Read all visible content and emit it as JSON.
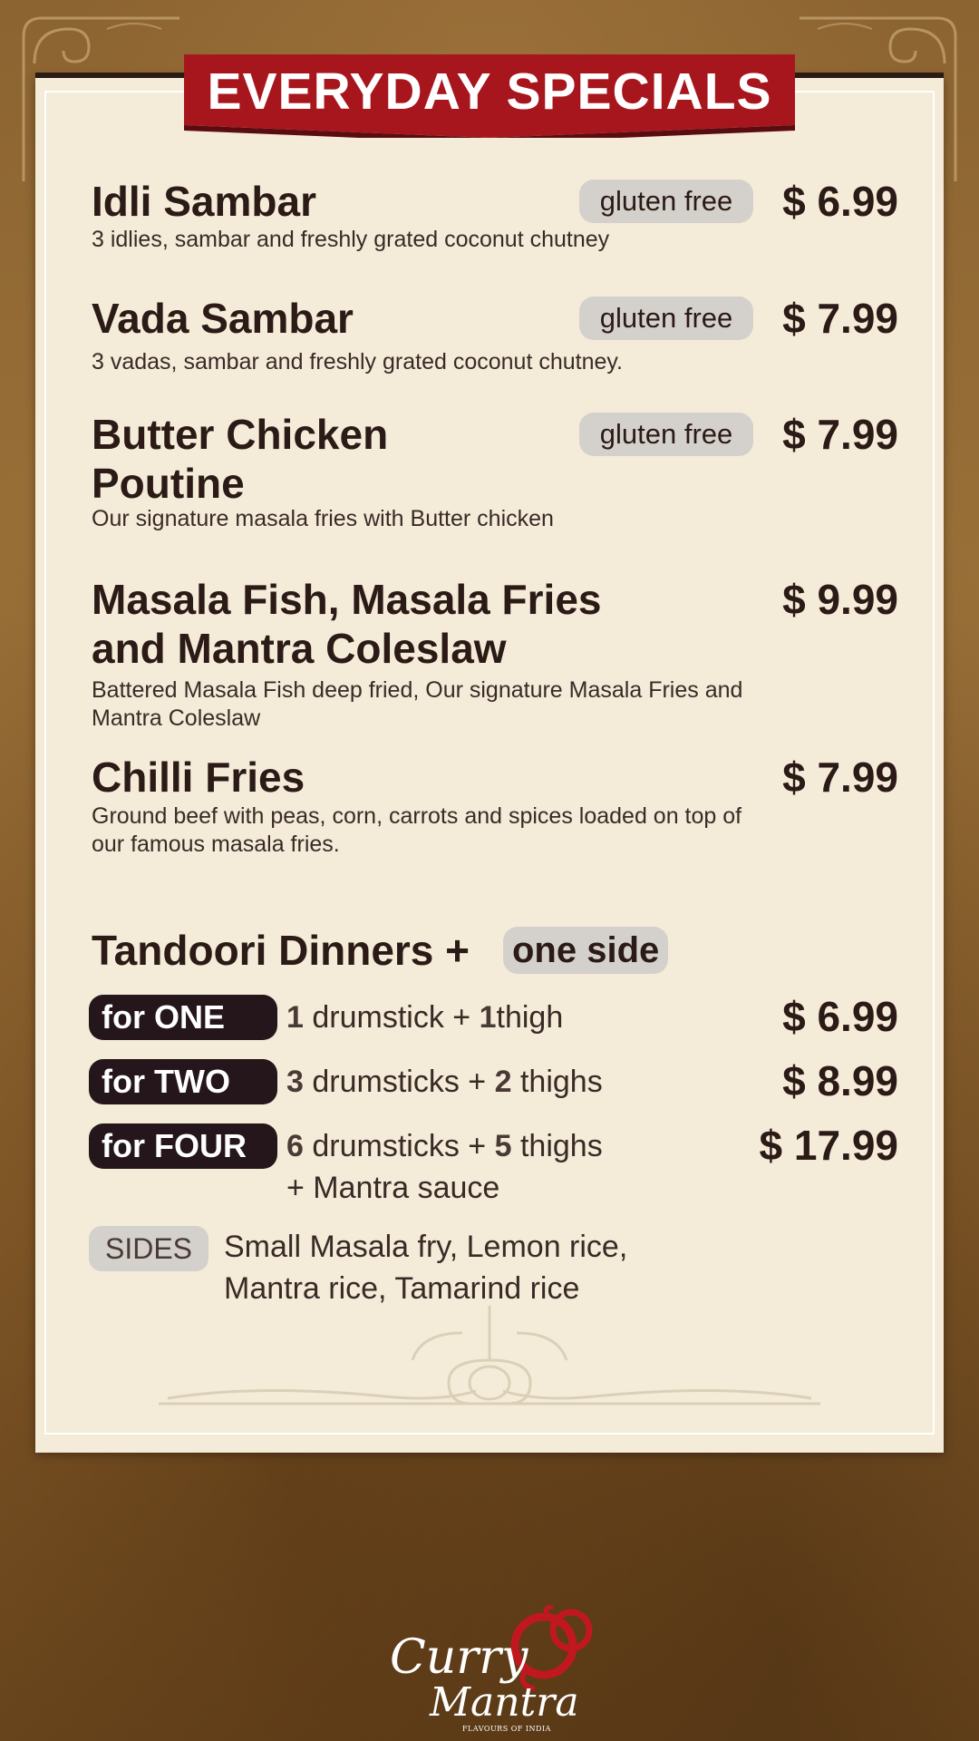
{
  "header": {
    "title": "EVERYDAY SPECIALS"
  },
  "badges": {
    "gluten_free": "gluten free"
  },
  "items": [
    {
      "name": "Idli Sambar",
      "price": "$ 6.99",
      "desc": "3 idlies, sambar and freshly grated coconut chutney",
      "gluten_free": true
    },
    {
      "name": "Vada Sambar",
      "price": "$ 7.99",
      "desc": "3 vadas, sambar and freshly grated coconut chutney.",
      "gluten_free": true
    },
    {
      "name_line1": "Butter Chicken",
      "name_line2": "Poutine",
      "price": "$ 7.99",
      "desc": "Our signature masala fries with Butter chicken",
      "gluten_free": true
    },
    {
      "name_line1": "Masala Fish, Masala Fries",
      "name_line2": "and Mantra Coleslaw",
      "price": "$ 9.99",
      "desc_line1": "Battered Masala Fish deep fried, Our signature Masala Fries and",
      "desc_line2": "Mantra Coleslaw",
      "gluten_free": false
    },
    {
      "name": "Chilli Fries",
      "price": "$ 7.99",
      "desc_line1": "Ground beef with peas, corn, carrots and spices loaded on top of",
      "desc_line2": "our famous masala fries.",
      "gluten_free": false
    }
  ],
  "tandoori": {
    "title": "Tandoori Dinners +",
    "side_badge": "one side",
    "portions": [
      {
        "label": "for ONE",
        "n1": "1",
        "t1": " drumstick + ",
        "n2": "1",
        "t2": "thigh",
        "price": "$ 6.99"
      },
      {
        "label": "for TWO",
        "n1": "3",
        "t1": " drumsticks + ",
        "n2": "2",
        "t2": " thighs",
        "price": "$ 8.99"
      },
      {
        "label": "for FOUR",
        "n1": "6",
        "t1": " drumsticks + ",
        "n2": "5",
        "t2": " thighs",
        "extra": "+ Mantra sauce",
        "price": "$ 17.99"
      }
    ],
    "sides_label": "SIDES",
    "sides_line1": "Small Masala fry, Lemon rice,",
    "sides_line2": "Mantra rice, Tamarind rice"
  },
  "logo": {
    "curry": "Curry",
    "mantra": "Mantra",
    "tagline": "FLAVOURS OF INDIA"
  },
  "colors": {
    "banner_red": "#a8161d",
    "text_dark": "#2b1a16",
    "panel": "#f4ecd9",
    "badge_grey": "#d4d1cc",
    "label_dark": "#24161a"
  }
}
